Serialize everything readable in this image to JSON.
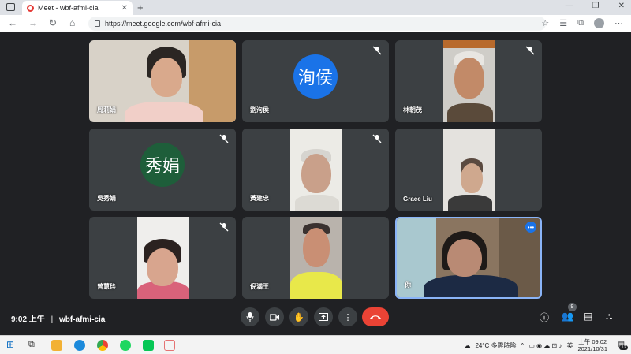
{
  "browser": {
    "tab_title": "Meet - wbf-afmi-cia",
    "url": "https://meet.google.com/wbf-afmi-cia"
  },
  "participants": [
    {
      "name": "周莉娟",
      "type": "video"
    },
    {
      "name": "劉洵侯",
      "type": "avatar",
      "avatar_text": "洵侯",
      "avatar_color": "#1a73e8",
      "muted": true
    },
    {
      "name": "林朝茂",
      "type": "video",
      "muted": true
    },
    {
      "name": "吳秀娟",
      "type": "avatar",
      "avatar_text": "秀娟",
      "avatar_color": "#1e5e3a",
      "muted": true
    },
    {
      "name": "黃建忠",
      "type": "video",
      "muted": true
    },
    {
      "name": "Grace Liu",
      "type": "video"
    },
    {
      "name": "曾慧珍",
      "type": "video",
      "muted": true
    },
    {
      "name": "倪滿王",
      "type": "video"
    },
    {
      "name": "你",
      "type": "video",
      "self": true
    }
  ],
  "meeting": {
    "time": "9:02 上午",
    "code": "wbf-afmi-cia",
    "participant_count": "9"
  },
  "taskbar": {
    "weather": "24°C 多雲時陰",
    "ime": "英",
    "time": "上午 09:02",
    "date": "2021/10/31",
    "notifications": "13"
  },
  "colors": {
    "background": "#202124",
    "tile": "#3c4043",
    "end_call": "#ea4335",
    "self_border": "#8ab4f8"
  }
}
